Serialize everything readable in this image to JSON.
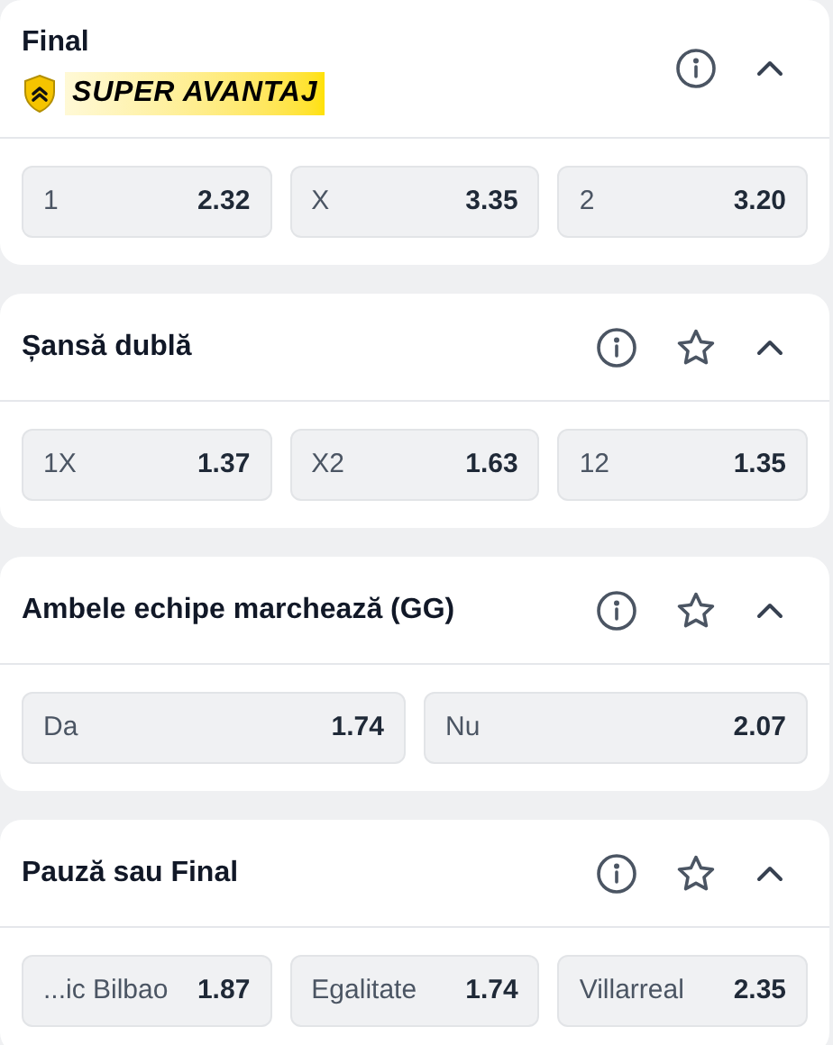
{
  "markets": [
    {
      "title": "Final",
      "badge": "SUPER AVANTAJ",
      "has_star": false,
      "expanded": true,
      "outcomes": [
        {
          "label": "1",
          "odds": "2.32"
        },
        {
          "label": "X",
          "odds": "3.35"
        },
        {
          "label": "2",
          "odds": "3.20"
        }
      ]
    },
    {
      "title": "Șansă dublă",
      "has_star": true,
      "expanded": true,
      "outcomes": [
        {
          "label": "1X",
          "odds": "1.37"
        },
        {
          "label": "X2",
          "odds": "1.63"
        },
        {
          "label": "12",
          "odds": "1.35"
        }
      ]
    },
    {
      "title": "Ambele echipe marchează (GG)",
      "has_star": true,
      "expanded": true,
      "outcomes": [
        {
          "label": "Da",
          "odds": "1.74"
        },
        {
          "label": "Nu",
          "odds": "2.07"
        }
      ]
    },
    {
      "title": "Pauză sau Final",
      "has_star": true,
      "expanded": true,
      "outcomes": [
        {
          "label": "...ic Bilbao",
          "odds": "1.87"
        },
        {
          "label": "Egalitate",
          "odds": "1.74"
        },
        {
          "label": "Villarreal",
          "odds": "2.35"
        }
      ]
    }
  ]
}
